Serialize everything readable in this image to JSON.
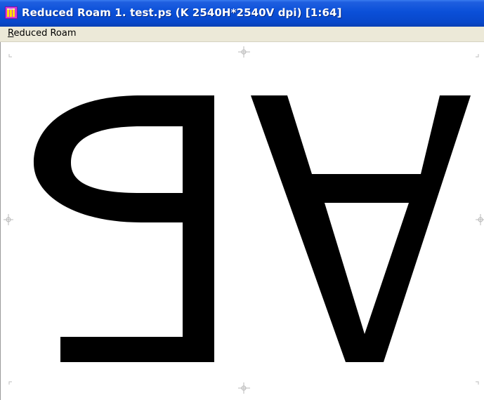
{
  "window": {
    "title": "Reduced Roam 1. test.ps  (K 2540H*2540V dpi)  [1:64]",
    "icon": "app-icon"
  },
  "menu": {
    "items": [
      {
        "label_first": "R",
        "label_rest": "educed Roam"
      }
    ]
  },
  "canvas": {
    "content": "mirrored and rotated glyphs",
    "glyphs": [
      "b",
      "A"
    ]
  }
}
